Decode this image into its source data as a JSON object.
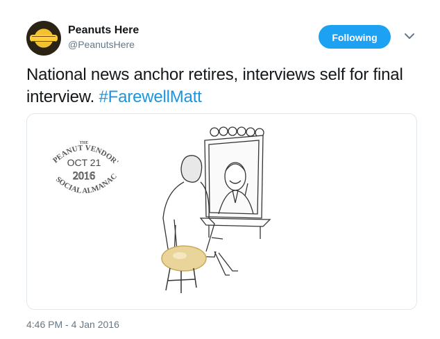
{
  "user": {
    "name": "Peanuts Here",
    "handle": "@PeanutsHere",
    "avatar_icon": "peanut-logo"
  },
  "follow_button": {
    "label": "Following",
    "color": "#1da1f2"
  },
  "more_icon": "chevron-down-icon",
  "tweet": {
    "text": "National news anchor retires, interviews self for final interview. ",
    "hashtag": "#FarewellMatt",
    "hashtag_color": "#1b95e0"
  },
  "media": {
    "stamp": {
      "the": "THE",
      "line1": "PEANUT VENDOR'S",
      "date": "OCT 21",
      "year": "2016",
      "line2": "SOCIAL ALMANAC"
    }
  },
  "timestamp": "4:46 PM - 4 Jan 2016"
}
